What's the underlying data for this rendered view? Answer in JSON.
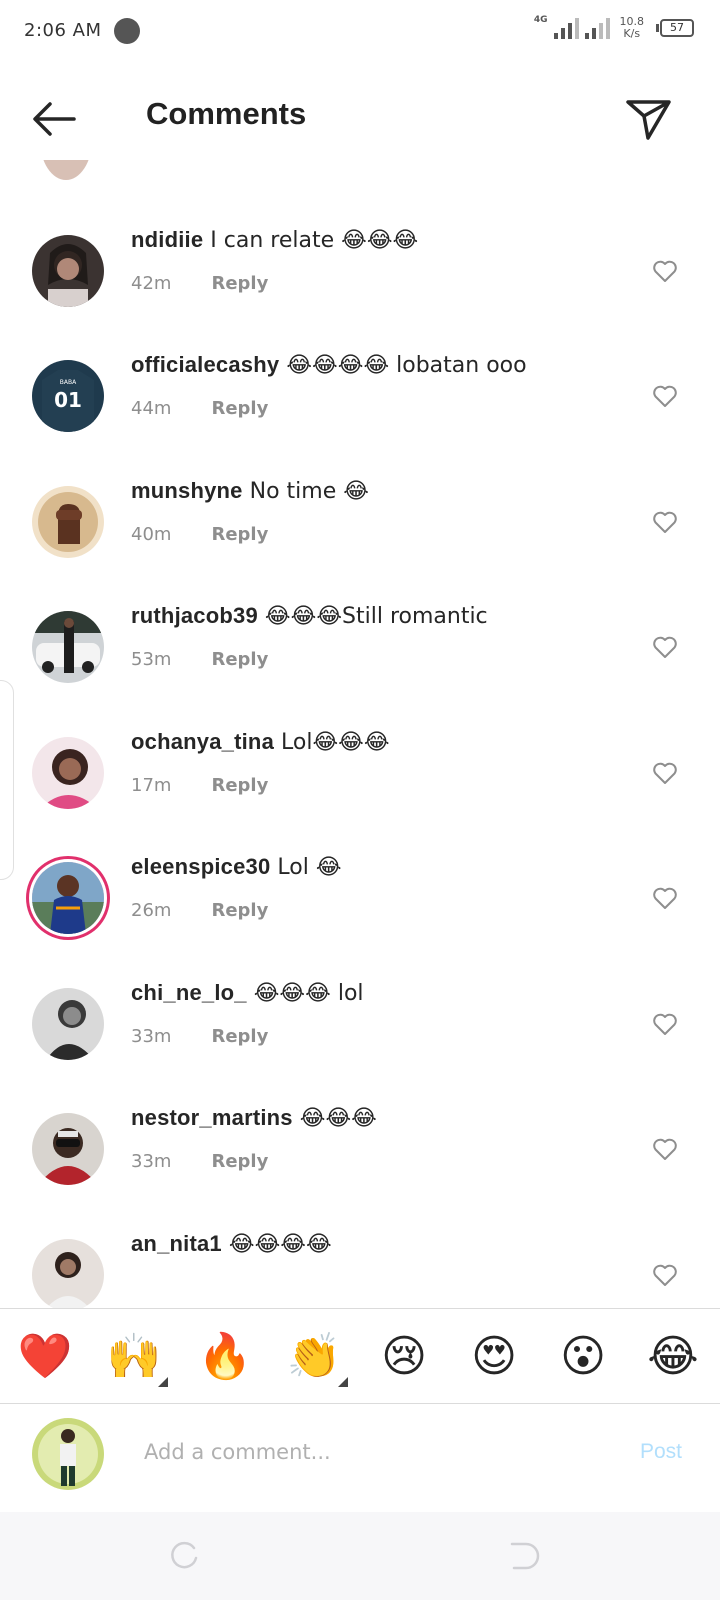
{
  "status_bar": {
    "time": "2:06 AM",
    "network": "4G",
    "speed_value": "10.8",
    "speed_unit": "K/s",
    "battery": "57"
  },
  "header": {
    "title": "Comments",
    "back_icon": "arrow-left-icon",
    "share_icon": "paper-plane-icon"
  },
  "comments": [
    {
      "username": "ndidiie",
      "text": "I can relate 😂😂😂",
      "time": "42m",
      "reply": "Reply"
    },
    {
      "username": "officialecashy",
      "text": "😂😂😂😂 lobatan ooo",
      "time": "44m",
      "reply": "Reply"
    },
    {
      "username": "munshyne",
      "text": "No time 😂",
      "time": "40m",
      "reply": "Reply"
    },
    {
      "username": "ruthjacob39",
      "text": "😂😂😂Still romantic",
      "time": "53m",
      "reply": "Reply"
    },
    {
      "username": "ochanya_tina",
      "text": "Lol😂😂😂",
      "time": "17m",
      "reply": "Reply"
    },
    {
      "username": "eleenspice30",
      "text": "Lol 😂",
      "time": "26m",
      "reply": "Reply"
    },
    {
      "username": "chi_ne_lo_",
      "text": "😂😂😂 lol",
      "time": "33m",
      "reply": "Reply"
    },
    {
      "username": "nestor_martins",
      "text": "😂😂😂",
      "time": "33m",
      "reply": "Reply"
    },
    {
      "username": "an_nita1",
      "text": "😂😂😂😂",
      "time": "",
      "reply": ""
    }
  ],
  "reactions": [
    "❤️",
    "🙌",
    "🔥",
    "👏",
    "😢",
    "😍",
    "😮",
    "😂"
  ],
  "composer": {
    "placeholder": "Add a comment...",
    "value": "",
    "post_label": "Post"
  },
  "colors": {
    "text": "#262626",
    "secondary": "#8e8e8e",
    "post_disabled": "#b2dffc",
    "story_ring": "#e1306c"
  }
}
